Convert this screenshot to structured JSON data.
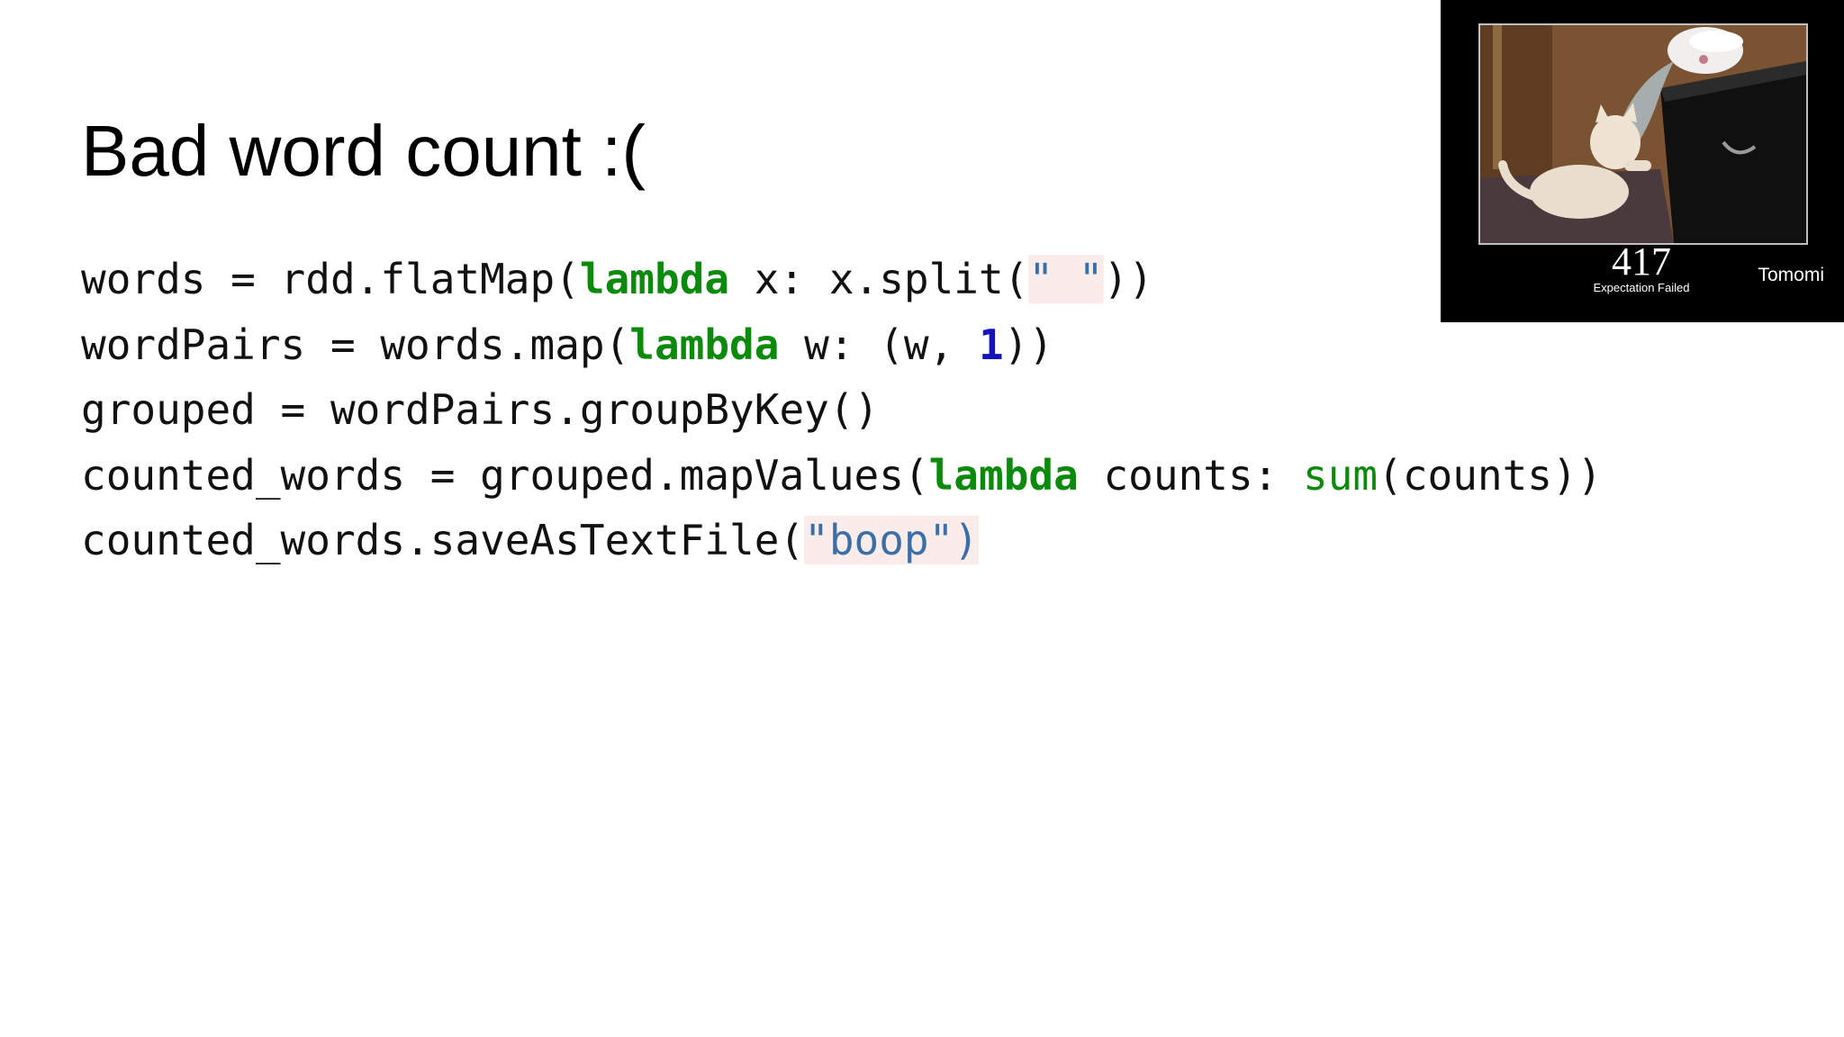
{
  "slide": {
    "title": "Bad word count :("
  },
  "code": {
    "line1": {
      "a": "words = rdd.flatMap(",
      "kw": "lambda",
      "b": " x: x.split(",
      "str": "\" \"",
      "c": "))"
    },
    "line2": {
      "a": "wordPairs = words.map(",
      "kw": "lambda",
      "b": " w: (w, ",
      "num": "1",
      "c": "))"
    },
    "line3": {
      "a": "grouped = wordPairs.groupByKey()"
    },
    "line4": {
      "a": "counted_words = grouped.mapValues(",
      "kw": "lambda",
      "b": " counts: ",
      "builtin": "sum",
      "c": "(counts))"
    },
    "line5": {
      "a": "counted_words.saveAsTextFile(",
      "str": "\"boop\")"
    }
  },
  "video_overlay": {
    "image_description_icon": "cat-water-bowl-image",
    "number": "417",
    "caption": "Expectation Failed",
    "presenter_name": "Tomomi"
  },
  "colors": {
    "keyword": "#0b8a0b",
    "number": "#1414b8",
    "string": "#3b6fa6",
    "string_bg": "#fbecec"
  }
}
